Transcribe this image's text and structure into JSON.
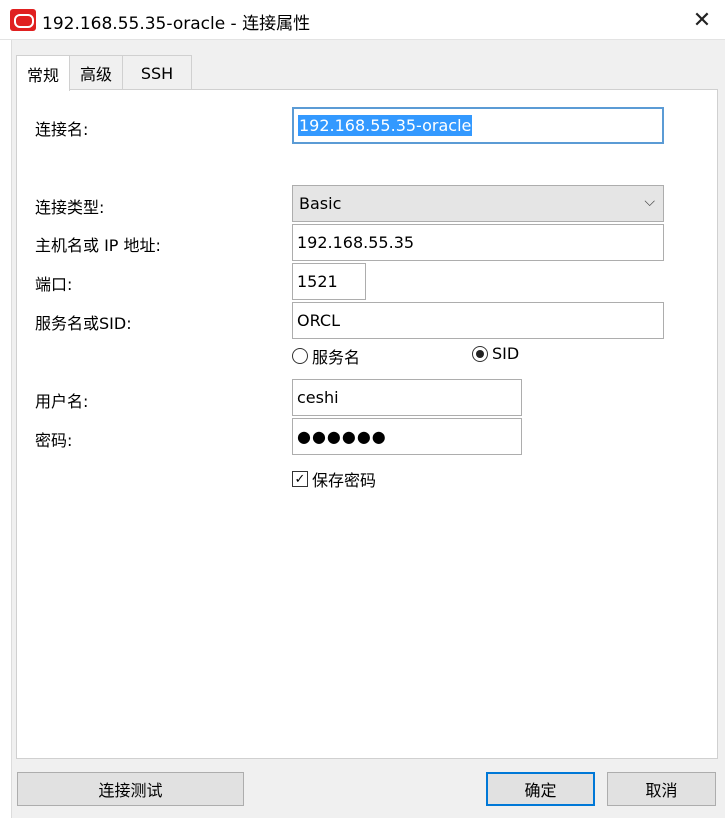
{
  "window": {
    "title": "192.168.55.35-oracle - 连接属性",
    "close_glyph": "✕"
  },
  "tabs": [
    {
      "label": "常规",
      "active": true
    },
    {
      "label": "高级",
      "active": false
    },
    {
      "label": "SSH",
      "active": false
    }
  ],
  "form": {
    "connection_name": {
      "label": "连接名:",
      "value": "192.168.55.35-oracle"
    },
    "connection_type": {
      "label": "连接类型:",
      "value": "Basic"
    },
    "host": {
      "label": "主机名或 IP 地址:",
      "value": "192.168.55.35"
    },
    "port": {
      "label": "端口:",
      "value": "1521"
    },
    "service": {
      "label": "服务名或SID:",
      "value": "ORCL"
    },
    "service_mode": {
      "options": [
        "服务名",
        "SID"
      ],
      "selected": "SID"
    },
    "username": {
      "label": "用户名:",
      "value": "ceshi"
    },
    "password": {
      "label": "密码:",
      "masked": "●●●●●●"
    },
    "save_password": {
      "label": "保存密码",
      "checked": true
    }
  },
  "buttons": {
    "test": "连接测试",
    "ok": "确定",
    "cancel": "取消"
  },
  "icons": {
    "app": "oracle-logo-icon",
    "dropdown": "chevron-down-icon",
    "check": "✓",
    "chevron": "⌵"
  },
  "colors": {
    "selection": "#3399ff",
    "focus_border": "#5b9bd5",
    "default_button_border": "#0078d7"
  }
}
